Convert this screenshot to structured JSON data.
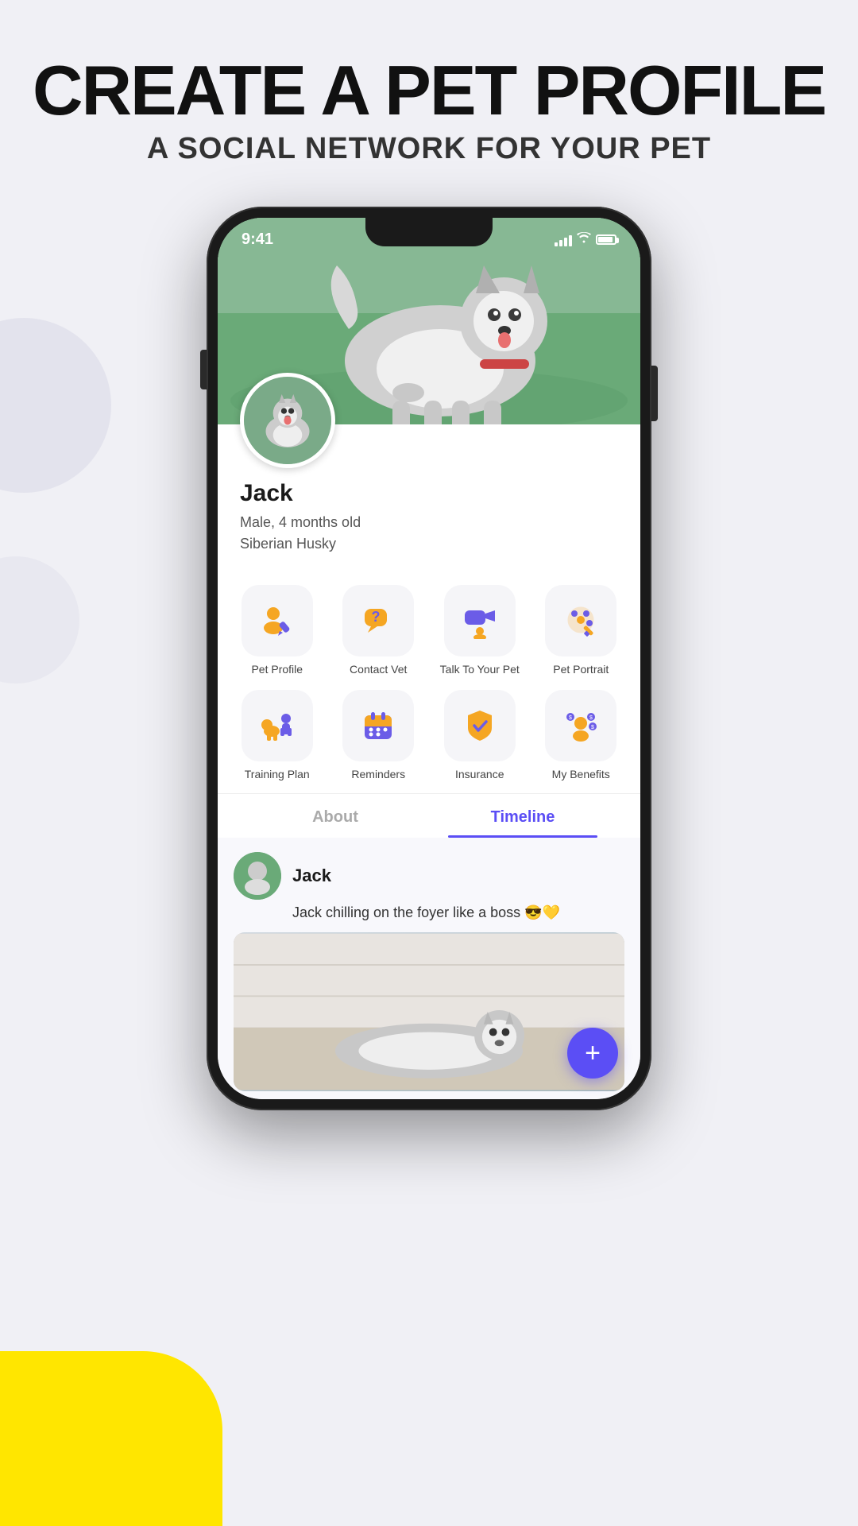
{
  "page": {
    "background_color": "#f0f0f5",
    "title": "CREATE A PET PROFILE",
    "subtitle": "A SOCIAL NETWORK FOR YOUR PET"
  },
  "phone": {
    "status_bar": {
      "time": "9:41",
      "signal": "full",
      "wifi": true,
      "battery": "full"
    }
  },
  "pet": {
    "name": "Jack",
    "details_line1": "Male, 4 months old",
    "details_line2": "Siberian Husky"
  },
  "features_row1": [
    {
      "label": "Pet Profile",
      "icon": "person-edit"
    },
    {
      "label": "Contact Vet",
      "icon": "chat-question"
    },
    {
      "label": "Talk To Your Pet",
      "icon": "video-chat"
    },
    {
      "label": "Pet Portrait",
      "icon": "palette"
    }
  ],
  "features_row2": [
    {
      "label": "Training Plan",
      "icon": "training"
    },
    {
      "label": "Reminders",
      "icon": "calendar"
    },
    {
      "label": "Insurance",
      "icon": "shield-check"
    },
    {
      "label": "My Benefits",
      "icon": "person-benefits"
    }
  ],
  "tabs": [
    {
      "label": "About",
      "active": false
    },
    {
      "label": "Timeline",
      "active": true
    }
  ],
  "timeline": {
    "post": {
      "author": "Jack",
      "caption": "Jack chilling on the foyer like a boss 😎💛"
    }
  },
  "fab": {
    "label": "+"
  }
}
